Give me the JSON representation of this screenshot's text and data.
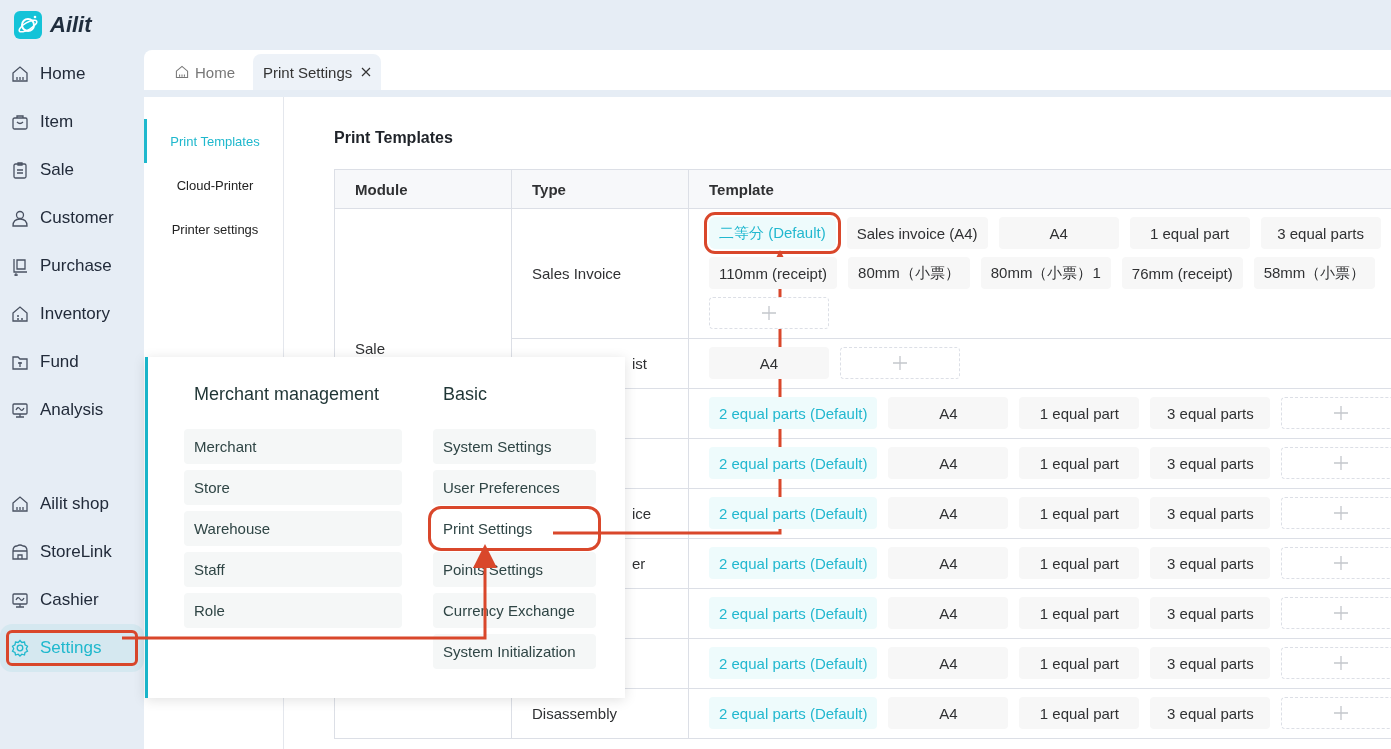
{
  "app": {
    "title": "Ailit"
  },
  "sidebar": {
    "main_items": [
      {
        "label": "Home",
        "selected": false,
        "highlighted": false
      },
      {
        "label": "Item",
        "selected": false,
        "highlighted": false
      },
      {
        "label": "Sale",
        "selected": false,
        "highlighted": false
      },
      {
        "label": "Customer",
        "selected": false,
        "highlighted": false
      },
      {
        "label": "Purchase",
        "selected": false,
        "highlighted": false
      },
      {
        "label": "Inventory",
        "selected": false,
        "highlighted": false
      },
      {
        "label": "Fund",
        "selected": false,
        "highlighted": false
      },
      {
        "label": "Analysis",
        "selected": false,
        "highlighted": false
      }
    ],
    "bottom_items": [
      {
        "label": "Ailit shop",
        "selected": false,
        "highlighted": false
      },
      {
        "label": "StoreLink",
        "selected": false,
        "highlighted": false
      },
      {
        "label": "Cashier",
        "selected": false,
        "highlighted": false
      },
      {
        "label": "Settings",
        "selected": true,
        "highlighted": true
      }
    ]
  },
  "tabs": [
    {
      "label": "Home",
      "selected": false,
      "closable": false
    },
    {
      "label": "Print Settings",
      "selected": true,
      "closable": true
    }
  ],
  "sub_nav": [
    {
      "label": "Print Templates",
      "selected": true
    },
    {
      "label": "Cloud-Printer",
      "selected": false
    },
    {
      "label": "Printer settings",
      "selected": false
    }
  ],
  "page_title": "Print Templates",
  "table": {
    "columns": [
      "Module",
      "Type",
      "Template"
    ],
    "modules": [
      {
        "name": "Sale",
        "rows": [
          {
            "type": "Sales Invoice",
            "templates": [
              {
                "label": "二等分 (Default)",
                "default": true,
                "highlighted": true
              },
              {
                "label": "Sales invoice (A4)",
                "default": false,
                "highlighted": false
              },
              {
                "label": "A4",
                "default": false,
                "highlighted": false
              },
              {
                "label": "1 equal part",
                "default": false,
                "highlighted": false
              },
              {
                "label": "3 equal parts",
                "default": false,
                "highlighted": false
              },
              {
                "label": "110mm (receipt)",
                "default": false,
                "highlighted": false
              },
              {
                "label": "80mm（小票）",
                "default": false,
                "highlighted": false
              },
              {
                "label": "80mm（小票）1",
                "default": false,
                "highlighted": false
              },
              {
                "label": "76mm (receipt)",
                "default": false,
                "highlighted": false
              },
              {
                "label": "58mm（小票）",
                "default": false,
                "highlighted": false
              }
            ]
          },
          {
            "type": "ist",
            "type_clipped": true,
            "templates": [
              {
                "label": "A4",
                "default": false,
                "highlighted": false
              }
            ]
          },
          {
            "templates": [
              {
                "label": "2 equal parts (Default)",
                "default": true,
                "highlighted": false
              },
              {
                "label": "A4",
                "default": false,
                "highlighted": false
              },
              {
                "label": "1 equal part",
                "default": false,
                "highlighted": false
              },
              {
                "label": "3 equal parts",
                "default": false,
                "highlighted": false
              }
            ]
          },
          {
            "templates": [
              {
                "label": "2 equal parts (Default)",
                "default": true,
                "highlighted": false
              },
              {
                "label": "A4",
                "default": false,
                "highlighted": false
              },
              {
                "label": "1 equal part",
                "default": false,
                "highlighted": false
              },
              {
                "label": "3 equal parts",
                "default": false,
                "highlighted": false
              }
            ]
          }
        ]
      },
      {
        "rows": [
          {
            "type": "ice",
            "type_clipped": true,
            "templates": [
              {
                "label": "2 equal parts (Default)",
                "default": true,
                "highlighted": false
              },
              {
                "label": "A4",
                "default": false,
                "highlighted": false
              },
              {
                "label": "1 equal part",
                "default": false,
                "highlighted": false
              },
              {
                "label": "3 equal parts",
                "default": false,
                "highlighted": false
              }
            ]
          },
          {
            "type": "er",
            "type_clipped": true,
            "templates": [
              {
                "label": "2 equal parts (Default)",
                "default": true,
                "highlighted": false
              },
              {
                "label": "A4",
                "default": false,
                "highlighted": false
              },
              {
                "label": "1 equal part",
                "default": false,
                "highlighted": false
              },
              {
                "label": "3 equal parts",
                "default": false,
                "highlighted": false
              }
            ]
          },
          {
            "templates": [
              {
                "label": "2 equal parts (Default)",
                "default": true,
                "highlighted": false
              },
              {
                "label": "A4",
                "default": false,
                "highlighted": false
              },
              {
                "label": "1 equal part",
                "default": false,
                "highlighted": false
              },
              {
                "label": "3 equal parts",
                "default": false,
                "highlighted": false
              }
            ]
          },
          {
            "templates": [
              {
                "label": "2 equal parts (Default)",
                "default": true,
                "highlighted": false
              },
              {
                "label": "A4",
                "default": false,
                "highlighted": false
              },
              {
                "label": "1 equal part",
                "default": false,
                "highlighted": false
              },
              {
                "label": "3 equal parts",
                "default": false,
                "highlighted": false
              }
            ]
          },
          {
            "type": "Disassembly",
            "templates": [
              {
                "label": "2 equal parts (Default)",
                "default": true,
                "highlighted": false
              },
              {
                "label": "A4",
                "default": false,
                "highlighted": false
              },
              {
                "label": "1 equal part",
                "default": false,
                "highlighted": false
              },
              {
                "label": "3 equal parts",
                "default": false,
                "highlighted": false
              }
            ]
          }
        ]
      }
    ]
  },
  "settings_menu": {
    "columns": [
      {
        "heading": "Merchant management",
        "items": [
          {
            "label": "Merchant",
            "highlighted": false
          },
          {
            "label": "Store",
            "highlighted": false
          },
          {
            "label": "Warehouse",
            "highlighted": false
          },
          {
            "label": "Staff",
            "highlighted": false
          },
          {
            "label": "Role",
            "highlighted": false
          }
        ]
      },
      {
        "heading": "Basic",
        "items": [
          {
            "label": "System Settings",
            "highlighted": false
          },
          {
            "label": "User Preferences",
            "highlighted": false
          },
          {
            "label": "Print Settings",
            "highlighted": true
          },
          {
            "label": "Points Settings",
            "highlighted": false
          },
          {
            "label": "Currency Exchange",
            "highlighted": false
          },
          {
            "label": "System Initialization",
            "highlighted": false
          }
        ]
      }
    ]
  }
}
